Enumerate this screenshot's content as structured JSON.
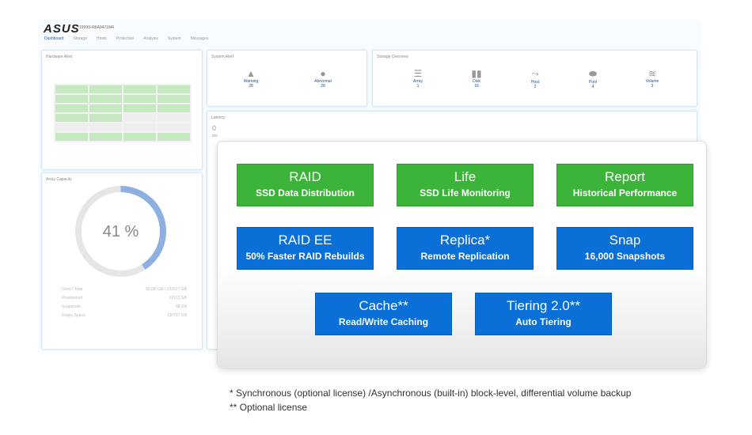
{
  "header": {
    "logo": "ASUS",
    "serial": "1999S-R6A0471M4"
  },
  "nav": [
    "Dashboard",
    "Storage",
    "Hosts",
    "Protection",
    "Analysis",
    "System",
    "Messages"
  ],
  "hardware_alert": {
    "title": "Hardware Alert"
  },
  "system_alert": {
    "title": "System Alert",
    "items": [
      {
        "icon": "warning-icon",
        "label": "Warning",
        "value": "28"
      },
      {
        "icon": "alert-circle-icon",
        "label": "Abnormal",
        "value": "28"
      }
    ]
  },
  "storage_overview": {
    "title": "Storage Overview",
    "items": [
      {
        "icon": "array-icon",
        "label": "Array",
        "value": "1"
      },
      {
        "icon": "disk-icon",
        "label": "Disk",
        "value": "16"
      },
      {
        "icon": "host-icon",
        "label": "Host",
        "value": "2"
      },
      {
        "icon": "pool-icon",
        "label": "Pool",
        "value": "4"
      },
      {
        "icon": "volume-icon",
        "label": "Volume",
        "value": "3"
      }
    ]
  },
  "latency": {
    "title": "Latency",
    "value": "0",
    "unit": "ms"
  },
  "array_capacity": {
    "title": "Array Capacity",
    "percent": 41,
    "percent_label": "41 %",
    "legend": [
      {
        "label": "Used / Total",
        "value": "92180 GB / 222917 GB"
      },
      {
        "label": "Provisioned",
        "value": "92113 GB"
      },
      {
        "label": "Snapshots",
        "value": "38 GB"
      },
      {
        "label": "Empty Space",
        "value": "130737 GB"
      }
    ]
  },
  "colors": {
    "green": "#3cb43a",
    "blue": "#0a6fd6"
  },
  "features": [
    {
      "title": "RAID",
      "subtitle": "SSD Data Distribution",
      "color": "green"
    },
    {
      "title": "Life",
      "subtitle": "SSD Life Monitoring",
      "color": "green"
    },
    {
      "title": "Report",
      "subtitle": "Historical Performance",
      "color": "green"
    },
    {
      "title": "RAID EE",
      "subtitle": "50% Faster RAID Rebuilds",
      "color": "blue"
    },
    {
      "title": "Replica*",
      "subtitle": "Remote Replication",
      "color": "blue"
    },
    {
      "title": "Snap",
      "subtitle": "16,000 Snapshots",
      "color": "blue"
    },
    {
      "title": "Cache**",
      "subtitle": "Read/Write Caching",
      "color": "blue"
    },
    {
      "title": "Tiering 2.0**",
      "subtitle": "Auto Tiering",
      "color": "blue"
    }
  ],
  "notes": [
    "*   Synchronous (optional license) /Asynchronous (built-in) block-level, differential volume backup",
    "** Optional license"
  ]
}
